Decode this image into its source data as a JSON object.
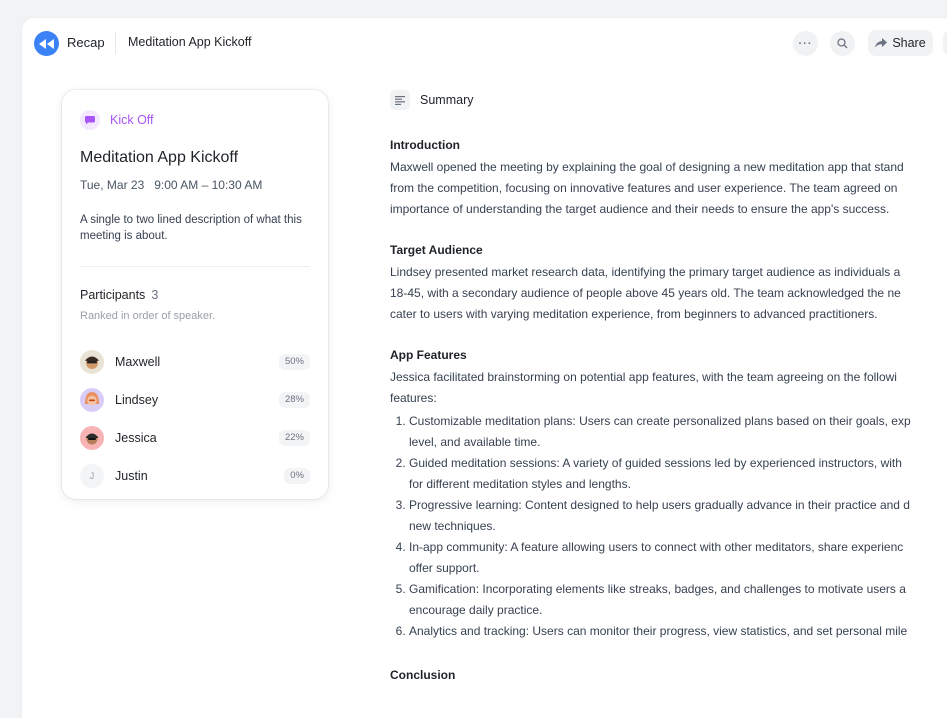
{
  "topbar": {
    "recap_label": "Recap",
    "title": "Meditation App Kickoff",
    "share_label": "Share"
  },
  "card": {
    "tag": "Kick Off",
    "title": "Meditation App Kickoff",
    "date": "Tue, Mar 23",
    "time": "9:00 AM – 10:30 AM",
    "description": "A single to two lined description of what this meeting is about.",
    "participants_label": "Participants",
    "participants_count": "3",
    "ranked_note": "Ranked in order of speaker.",
    "participants": [
      {
        "name": "Maxwell",
        "pct": "50%",
        "initial": ""
      },
      {
        "name": "Lindsey",
        "pct": "28%",
        "initial": ""
      },
      {
        "name": "Jessica",
        "pct": "22%",
        "initial": ""
      },
      {
        "name": "Justin",
        "pct": "0%",
        "initial": "J"
      }
    ]
  },
  "summary": {
    "heading": "Summary",
    "intro_title": "Introduction",
    "intro_lines": [
      "Maxwell opened the meeting by explaining the goal of designing a new meditation app that stand",
      "from the competition, focusing on innovative features and user experience. The team agreed on",
      "importance of understanding the target audience and their needs to ensure the app's success."
    ],
    "audience_title": "Target Audience",
    "audience_lines": [
      "Lindsey presented market research data, identifying the primary target audience as individuals a",
      "18-45, with a secondary audience of people above 45 years old. The team acknowledged the ne",
      "cater to users with varying meditation experience, from beginners to advanced practitioners."
    ],
    "features_title": "App Features",
    "features_lines": [
      "Jessica facilitated brainstorming on potential app features, with the team agreeing on the followi",
      "features:"
    ],
    "features": [
      [
        "Customizable meditation plans: Users can create personalized plans based on their goals, exp",
        "level, and available time."
      ],
      [
        "Guided meditation sessions: A variety of guided sessions led by experienced instructors, with",
        "for different meditation styles and lengths."
      ],
      [
        "Progressive learning: Content designed to help users gradually advance in their practice and d",
        "new techniques."
      ],
      [
        "In-app community: A feature allowing users to connect with other meditators, share experienc",
        "offer support."
      ],
      [
        "Gamification: Incorporating elements like streaks, badges, and challenges to motivate users a",
        "encourage daily practice."
      ],
      [
        "Analytics and tracking: Users can monitor their progress, view statistics, and set personal mile"
      ]
    ],
    "conclusion_title": "Conclusion"
  }
}
